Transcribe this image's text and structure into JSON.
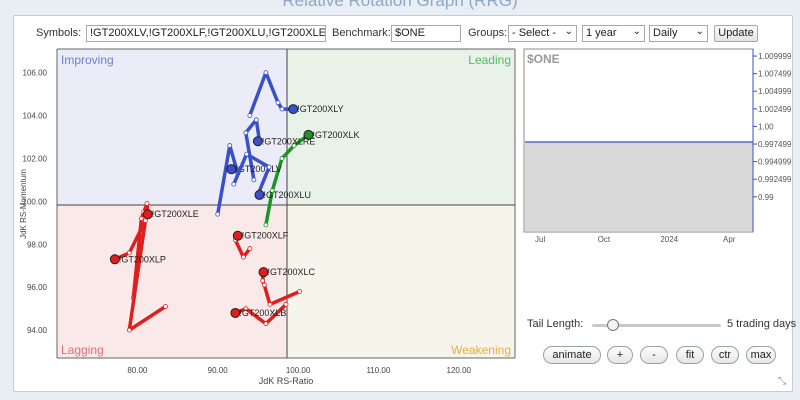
{
  "page": {
    "title": "Relative Rotation Graph (RRG)"
  },
  "controls": {
    "symbols_label": "Symbols:",
    "symbols_value": "!GT200XLV,!GT200XLF,!GT200XLU,!GT200XLE,!G",
    "benchmark_label": "Benchmark:",
    "benchmark_value": "$ONE",
    "groups_label": "Groups:",
    "groups_value": "- Select -",
    "period_value": "1 year",
    "frequency_value": "Daily",
    "update_label": "Update"
  },
  "rrg": {
    "quadrants": {
      "improving": "Improving",
      "leading": "Leading",
      "lagging": "Lagging",
      "weakening": "Weakening"
    },
    "xlabel": "JdK RS-Ratio",
    "ylabel": "JdK RS-Momentum",
    "x_ticks": [
      "80.00",
      "90.00",
      "100.00",
      "110.00",
      "120.00"
    ],
    "y_ticks": [
      "106.00",
      "104.00",
      "102.00",
      "100.00",
      "98.00",
      "96.00",
      "94.00"
    ]
  },
  "chart_data": {
    "type": "scatter",
    "title": "",
    "xlabel": "JdK RS-Ratio",
    "ylabel": "JdK RS-Momentum",
    "xlim": [
      70,
      127
    ],
    "ylim": [
      92.7,
      107.1
    ],
    "center": [
      100,
      100
    ],
    "grid": false,
    "series": [
      {
        "name": "!GT200XLY",
        "color": "#3a4fc8",
        "tail": [
          [
            94.0,
            104.0
          ],
          [
            96.0,
            106.0
          ],
          [
            97.5,
            104.6
          ],
          [
            98.0,
            104.3
          ],
          [
            99.4,
            104.3
          ]
        ]
      },
      {
        "name": "!GT200XLK",
        "color": "#18961d",
        "tail": [
          [
            96.0,
            98.9
          ],
          [
            96.8,
            100.5
          ],
          [
            98.0,
            102.0
          ],
          [
            99.5,
            102.6
          ],
          [
            101.3,
            103.1
          ]
        ]
      },
      {
        "name": "!GT200XLRE",
        "color": "#3a4fc8",
        "tail": [
          [
            94.5,
            101.0
          ],
          [
            93.5,
            103.2
          ],
          [
            94.8,
            103.8
          ],
          [
            95.2,
            102.8
          ],
          [
            95.0,
            102.8
          ]
        ]
      },
      {
        "name": "!GT200XLV",
        "color": "#3a4fc8",
        "tail": [
          [
            90.0,
            99.4
          ],
          [
            91.5,
            102.6
          ],
          [
            92.5,
            101.3
          ],
          [
            91.8,
            101.6
          ],
          [
            91.7,
            101.5
          ]
        ]
      },
      {
        "name": "!GT200XLU",
        "color": "#3a4fc8",
        "tail": [
          [
            92.0,
            100.8
          ],
          [
            93.6,
            102.2
          ],
          [
            96.4,
            101.6
          ],
          [
            95.0,
            100.3
          ],
          [
            95.2,
            100.3
          ]
        ]
      },
      {
        "name": "!GT200XLE",
        "color": "#e11d1d",
        "tail": [
          [
            79.5,
            95.5
          ],
          [
            80.5,
            99.2
          ],
          [
            80.8,
            99.5
          ],
          [
            81.2,
            99.9
          ],
          [
            81.3,
            99.4
          ]
        ]
      },
      {
        "name": "!GT200XLP",
        "color": "#e11d1d",
        "tail": [
          [
            83.5,
            95.1
          ],
          [
            79.0,
            94.0
          ],
          [
            81.0,
            99.1
          ],
          [
            79.0,
            97.6
          ],
          [
            77.2,
            97.3
          ]
        ]
      },
      {
        "name": "!GT200XLF",
        "color": "#e11d1d",
        "tail": [
          [
            94.0,
            97.8
          ],
          [
            93.2,
            97.4
          ],
          [
            92.2,
            98.2
          ],
          [
            92.4,
            98.5
          ],
          [
            92.5,
            98.4
          ]
        ]
      },
      {
        "name": "!GT200XLC",
        "color": "#e11d1d",
        "tail": [
          [
            100.2,
            95.8
          ],
          [
            96.5,
            95.2
          ],
          [
            95.8,
            96.1
          ],
          [
            95.6,
            96.3
          ],
          [
            95.7,
            96.7
          ]
        ]
      },
      {
        "name": "!GT200XLB",
        "color": "#e11d1d",
        "tail": [
          [
            98.5,
            95.2
          ],
          [
            96.0,
            94.3
          ],
          [
            93.5,
            95.0
          ],
          [
            92.3,
            94.8
          ],
          [
            92.2,
            94.8
          ]
        ]
      }
    ]
  },
  "benchmark_chart": {
    "label": "$ONE",
    "series_value": 1.0,
    "ylim": [
      0.985,
      1.011
    ],
    "y_ticks": [
      "1.009999",
      "1.007499",
      "1.004999",
      "1.002499",
      "1.00",
      "0.997499",
      "0.994999",
      "0.992499",
      "0.99"
    ],
    "x_ticks": [
      "Jul",
      "Oct",
      "2024",
      "Apr"
    ]
  },
  "tail": {
    "label": "Tail Length:",
    "value_text": "5 trading days",
    "slider_fraction": 0.16
  },
  "buttons": {
    "animate": "animate",
    "zoom_in": "+",
    "zoom_out": "-",
    "fit": "fit",
    "ctr": "ctr",
    "max": "max"
  }
}
